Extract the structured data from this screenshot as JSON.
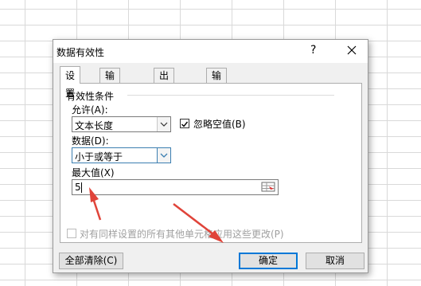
{
  "dialog": {
    "title": "数据有效性",
    "help": "?",
    "close_icon": "close-icon"
  },
  "tabs": [
    {
      "label": "设置",
      "active": true
    },
    {
      "label": "输入信息",
      "active": false
    },
    {
      "label": "出错警告",
      "active": false
    },
    {
      "label": "输入法模式",
      "active": false
    }
  ],
  "criteria": {
    "group_label": "有效性条件",
    "allow_label": "允许(A):",
    "allow_value": "文本长度",
    "ignore_blank_label": "忽略空值(B)",
    "ignore_blank_checked": true,
    "data_label": "数据(D):",
    "data_value": "小于或等于",
    "max_label": "最大值(X)",
    "max_value": "5",
    "apply_all_label": "对有同样设置的所有其他单元格应用这些更改(P)",
    "apply_all_checked": false
  },
  "buttons": {
    "clear_all": "全部清除(C)",
    "ok": "确定",
    "cancel": "取消"
  },
  "colors": {
    "annotation_arrow": "#e0443a",
    "focus_border": "#3c7fb1",
    "default_button_border": "#0078d7"
  }
}
